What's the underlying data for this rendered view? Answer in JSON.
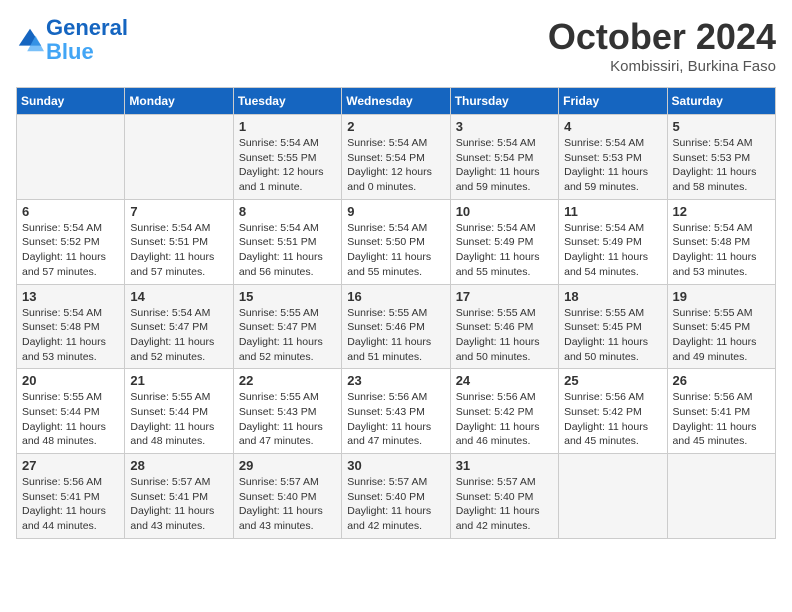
{
  "header": {
    "logo_line1": "General",
    "logo_line2": "Blue",
    "month": "October 2024",
    "location": "Kombissiri, Burkina Faso"
  },
  "weekdays": [
    "Sunday",
    "Monday",
    "Tuesday",
    "Wednesday",
    "Thursday",
    "Friday",
    "Saturday"
  ],
  "weeks": [
    [
      {
        "day": "",
        "info": ""
      },
      {
        "day": "",
        "info": ""
      },
      {
        "day": "1",
        "info": "Sunrise: 5:54 AM\nSunset: 5:55 PM\nDaylight: 12 hours\nand 1 minute."
      },
      {
        "day": "2",
        "info": "Sunrise: 5:54 AM\nSunset: 5:54 PM\nDaylight: 12 hours\nand 0 minutes."
      },
      {
        "day": "3",
        "info": "Sunrise: 5:54 AM\nSunset: 5:54 PM\nDaylight: 11 hours\nand 59 minutes."
      },
      {
        "day": "4",
        "info": "Sunrise: 5:54 AM\nSunset: 5:53 PM\nDaylight: 11 hours\nand 59 minutes."
      },
      {
        "day": "5",
        "info": "Sunrise: 5:54 AM\nSunset: 5:53 PM\nDaylight: 11 hours\nand 58 minutes."
      }
    ],
    [
      {
        "day": "6",
        "info": "Sunrise: 5:54 AM\nSunset: 5:52 PM\nDaylight: 11 hours\nand 57 minutes."
      },
      {
        "day": "7",
        "info": "Sunrise: 5:54 AM\nSunset: 5:51 PM\nDaylight: 11 hours\nand 57 minutes."
      },
      {
        "day": "8",
        "info": "Sunrise: 5:54 AM\nSunset: 5:51 PM\nDaylight: 11 hours\nand 56 minutes."
      },
      {
        "day": "9",
        "info": "Sunrise: 5:54 AM\nSunset: 5:50 PM\nDaylight: 11 hours\nand 55 minutes."
      },
      {
        "day": "10",
        "info": "Sunrise: 5:54 AM\nSunset: 5:49 PM\nDaylight: 11 hours\nand 55 minutes."
      },
      {
        "day": "11",
        "info": "Sunrise: 5:54 AM\nSunset: 5:49 PM\nDaylight: 11 hours\nand 54 minutes."
      },
      {
        "day": "12",
        "info": "Sunrise: 5:54 AM\nSunset: 5:48 PM\nDaylight: 11 hours\nand 53 minutes."
      }
    ],
    [
      {
        "day": "13",
        "info": "Sunrise: 5:54 AM\nSunset: 5:48 PM\nDaylight: 11 hours\nand 53 minutes."
      },
      {
        "day": "14",
        "info": "Sunrise: 5:54 AM\nSunset: 5:47 PM\nDaylight: 11 hours\nand 52 minutes."
      },
      {
        "day": "15",
        "info": "Sunrise: 5:55 AM\nSunset: 5:47 PM\nDaylight: 11 hours\nand 52 minutes."
      },
      {
        "day": "16",
        "info": "Sunrise: 5:55 AM\nSunset: 5:46 PM\nDaylight: 11 hours\nand 51 minutes."
      },
      {
        "day": "17",
        "info": "Sunrise: 5:55 AM\nSunset: 5:46 PM\nDaylight: 11 hours\nand 50 minutes."
      },
      {
        "day": "18",
        "info": "Sunrise: 5:55 AM\nSunset: 5:45 PM\nDaylight: 11 hours\nand 50 minutes."
      },
      {
        "day": "19",
        "info": "Sunrise: 5:55 AM\nSunset: 5:45 PM\nDaylight: 11 hours\nand 49 minutes."
      }
    ],
    [
      {
        "day": "20",
        "info": "Sunrise: 5:55 AM\nSunset: 5:44 PM\nDaylight: 11 hours\nand 48 minutes."
      },
      {
        "day": "21",
        "info": "Sunrise: 5:55 AM\nSunset: 5:44 PM\nDaylight: 11 hours\nand 48 minutes."
      },
      {
        "day": "22",
        "info": "Sunrise: 5:55 AM\nSunset: 5:43 PM\nDaylight: 11 hours\nand 47 minutes."
      },
      {
        "day": "23",
        "info": "Sunrise: 5:56 AM\nSunset: 5:43 PM\nDaylight: 11 hours\nand 47 minutes."
      },
      {
        "day": "24",
        "info": "Sunrise: 5:56 AM\nSunset: 5:42 PM\nDaylight: 11 hours\nand 46 minutes."
      },
      {
        "day": "25",
        "info": "Sunrise: 5:56 AM\nSunset: 5:42 PM\nDaylight: 11 hours\nand 45 minutes."
      },
      {
        "day": "26",
        "info": "Sunrise: 5:56 AM\nSunset: 5:41 PM\nDaylight: 11 hours\nand 45 minutes."
      }
    ],
    [
      {
        "day": "27",
        "info": "Sunrise: 5:56 AM\nSunset: 5:41 PM\nDaylight: 11 hours\nand 44 minutes."
      },
      {
        "day": "28",
        "info": "Sunrise: 5:57 AM\nSunset: 5:41 PM\nDaylight: 11 hours\nand 43 minutes."
      },
      {
        "day": "29",
        "info": "Sunrise: 5:57 AM\nSunset: 5:40 PM\nDaylight: 11 hours\nand 43 minutes."
      },
      {
        "day": "30",
        "info": "Sunrise: 5:57 AM\nSunset: 5:40 PM\nDaylight: 11 hours\nand 42 minutes."
      },
      {
        "day": "31",
        "info": "Sunrise: 5:57 AM\nSunset: 5:40 PM\nDaylight: 11 hours\nand 42 minutes."
      },
      {
        "day": "",
        "info": ""
      },
      {
        "day": "",
        "info": ""
      }
    ]
  ]
}
